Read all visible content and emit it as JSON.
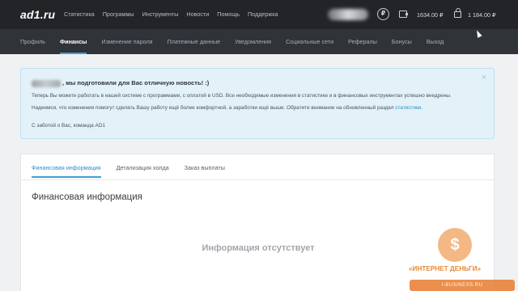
{
  "header": {
    "logo": "ad1.ru",
    "nav": [
      "Статистика",
      "Программы",
      "Инструменты",
      "Новости",
      "Помощь",
      "Поддержка"
    ],
    "balance_primary": "1634.00 ₽",
    "balance_hold": "1 184.00 ₽",
    "ruble_symbol": "₽"
  },
  "subnav": {
    "items": [
      "Профиль",
      "Финансы",
      "Изменение пароля",
      "Платежные данные",
      "Уведомления",
      "Социальные сети",
      "Рефералы",
      "Бонусы",
      "Выход"
    ],
    "active_index": 1
  },
  "notice": {
    "title_suffix": ", мы подготовили для Вас отличную новость! :)",
    "line1": "Теперь Вы можете работать в нашей системе с программами, с оплатой в USD. Все необходимые изменения в статистике и в финансовых инструментах успешно внедрены.",
    "line2_prefix": "Надеемся, что изменения помогут сделать Вашу работу ещё более комфортной, а заработки ещё выше. Обратите внимание на обновленный раздел",
    "line2_link": "статистики",
    "line2_suffix": ".",
    "signature": "С заботой о Вас, команда AD1",
    "close_glyph": "×"
  },
  "finance": {
    "tabs": [
      "Финансовая информация",
      "Детализация холда",
      "Заказ выплаты"
    ],
    "active_tab": 0,
    "title": "Финансовая информация",
    "empty_message": "Информация отсутствует"
  },
  "watermark": {
    "text": "«ИНТЕРНЕТ ДЕНЬГИ»",
    "sub": "I-BUSINESS.RU",
    "symbol": "$"
  },
  "colors": {
    "accent": "#3aa1d6",
    "topbar": "#222428",
    "subnav": "#303338",
    "notice_bg": "#e3f1f9"
  }
}
